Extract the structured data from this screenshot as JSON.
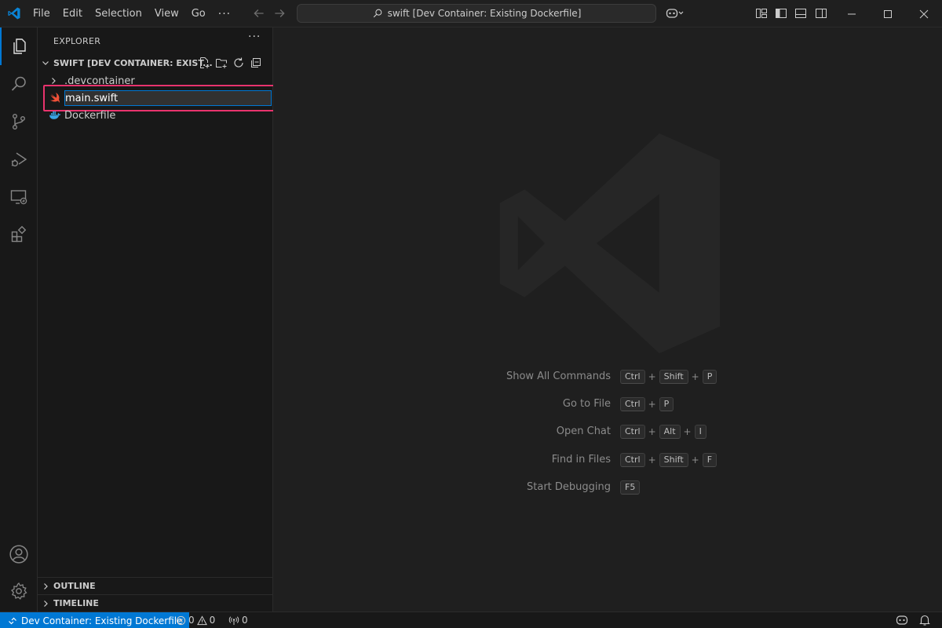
{
  "titlebar": {
    "menu": [
      "File",
      "Edit",
      "Selection",
      "View",
      "Go"
    ],
    "more": "···",
    "command_center": "swift [Dev Container: Existing Dockerfile]"
  },
  "activity_bar": {
    "icons": [
      "explorer-icon",
      "search-icon",
      "source-control-icon",
      "run-debug-icon",
      "remote-explorer-icon",
      "extensions-icon",
      "accounts-icon",
      "manage-gear-icon"
    ]
  },
  "sidebar": {
    "title": "EXPLORER",
    "more": "···",
    "folder": "SWIFT [DEV CONTAINER: EXIST...",
    "tree": [
      {
        "label": ".devcontainer",
        "type": "folder"
      },
      {
        "label": "main.swift",
        "type": "file",
        "editing": true
      },
      {
        "label": "Dockerfile",
        "type": "file"
      }
    ],
    "outline": "OUTLINE",
    "timeline": "TIMELINE"
  },
  "editor": {
    "shortcuts": [
      {
        "label": "Show All Commands",
        "keys": [
          "Ctrl",
          "Shift",
          "P"
        ]
      },
      {
        "label": "Go to File",
        "keys": [
          "Ctrl",
          "P"
        ]
      },
      {
        "label": "Open Chat",
        "keys": [
          "Ctrl",
          "Alt",
          "I"
        ]
      },
      {
        "label": "Find in Files",
        "keys": [
          "Ctrl",
          "Shift",
          "F"
        ]
      },
      {
        "label": "Start Debugging",
        "keys": [
          "F5"
        ]
      }
    ]
  },
  "statusbar": {
    "remote": "Dev Container: Existing Dockerfile",
    "errors": "0",
    "warnings": "0",
    "ports": "0"
  },
  "colors": {
    "accent": "#0078d4",
    "highlight": "#e8336d",
    "swift": "#f05138",
    "docker": "#3aa4e6"
  }
}
